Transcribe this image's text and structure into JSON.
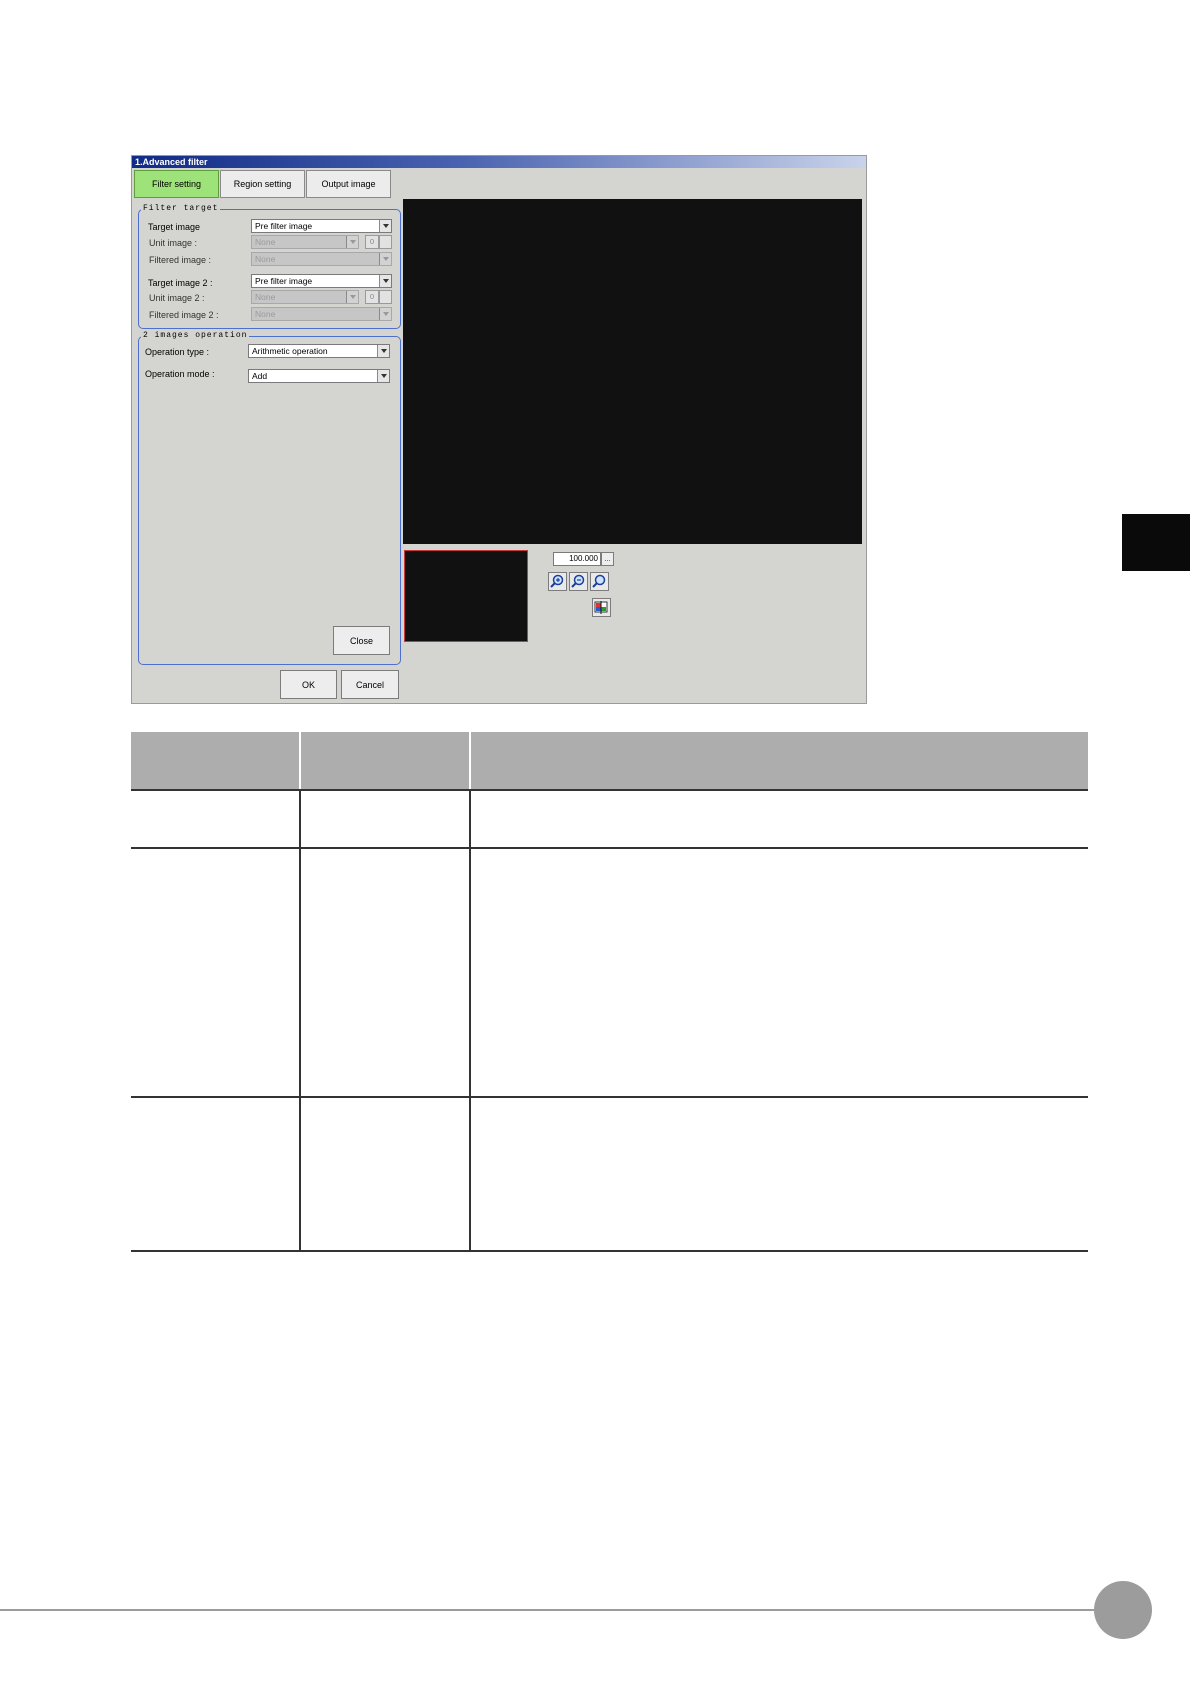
{
  "window": {
    "title": "1.Advanced filter",
    "tabs": [
      {
        "label": "Filter setting",
        "active": true
      },
      {
        "label": "Region setting",
        "active": false
      },
      {
        "label": "Output image",
        "active": false
      }
    ]
  },
  "filter_target": {
    "title": "Filter target",
    "target_image_label": "Target image",
    "target_image_value": "Pre filter image",
    "unit_image_label": "Unit image :",
    "unit_image_value": "None",
    "unit_image_number": "0",
    "filtered_image_label": "Filtered image :",
    "filtered_image_value": "None",
    "target_image2_label": "Target image 2 :",
    "target_image2_value": "Pre filter image",
    "unit_image2_label": "Unit image 2 :",
    "unit_image2_value": "None",
    "unit_image2_number": "0",
    "filtered_image2_label": "Filtered image 2 :",
    "filtered_image2_value": "None"
  },
  "images_operation": {
    "title": "2 images operation",
    "operation_type_label": "Operation type :",
    "operation_type_value": "Arithmetic operation",
    "operation_mode_label": "Operation mode :",
    "operation_mode_value": "Add",
    "close_label": "Close"
  },
  "footer_buttons": {
    "ok_label": "OK",
    "cancel_label": "Cancel"
  },
  "zoom": {
    "value": "100.000",
    "more_label": "..."
  },
  "icons": [
    "zoom-in-icon",
    "zoom-out-icon",
    "zoom-fit-icon",
    "display-settings-icon"
  ],
  "colors": {
    "active_tab": "#9ee27a",
    "group_border": "#4d6fd0",
    "title_bar": "#102b86",
    "table_header": "#adadad"
  }
}
